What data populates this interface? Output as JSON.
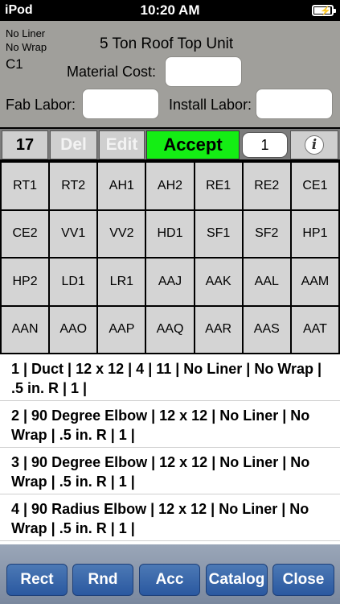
{
  "status_bar": {
    "carrier": "iPod",
    "time": "10:20 AM"
  },
  "header": {
    "liner": "No Liner",
    "wrap": "No Wrap",
    "code": "C1",
    "title": "5 Ton Roof Top Unit",
    "material_cost_label": "Material Cost:",
    "fab_labor_label": "Fab Labor:",
    "install_labor_label": "Install Labor:"
  },
  "toolbar": {
    "count": "17",
    "del_label": "Del",
    "edit_label": "Edit",
    "accept_label": "Accept",
    "quantity": "1",
    "info_glyph": "i"
  },
  "grid": {
    "cells": [
      "RT1",
      "RT2",
      "AH1",
      "AH2",
      "RE1",
      "RE2",
      "CE1",
      "CE2",
      "VV1",
      "VV2",
      "HD1",
      "SF1",
      "SF2",
      "HP1",
      "HP2",
      "LD1",
      "LR1",
      "AAJ",
      "AAK",
      "AAL",
      "AAM",
      "AAN",
      "AAO",
      "AAP",
      "AAQ",
      "AAR",
      "AAS",
      "AAT"
    ]
  },
  "list": {
    "items": [
      "1 | Duct | 12 x 12 | 4 | 11 | No Liner | No Wrap | .5 in. R | 1 |",
      "2 | 90 Degree Elbow | 12 x 12 | No Liner | No Wrap | .5 in. R | 1 |",
      "3 | 90 Degree Elbow | 12 x 12 | No Liner | No Wrap | .5 in. R | 1 |",
      "4 | 90 Radius Elbow | 12 x 12 | No Liner | No Wrap | .5 in. R | 1 |"
    ]
  },
  "bottom_bar": {
    "rect_label": "Rect",
    "rnd_label": "Rnd",
    "acc_label": "Acc",
    "catalog_label": "Catalog",
    "close_label": "Close"
  },
  "colors": {
    "accept": "#14ee14",
    "header_bg": "#a09f9b",
    "bottom_button": "#2a58a0"
  }
}
